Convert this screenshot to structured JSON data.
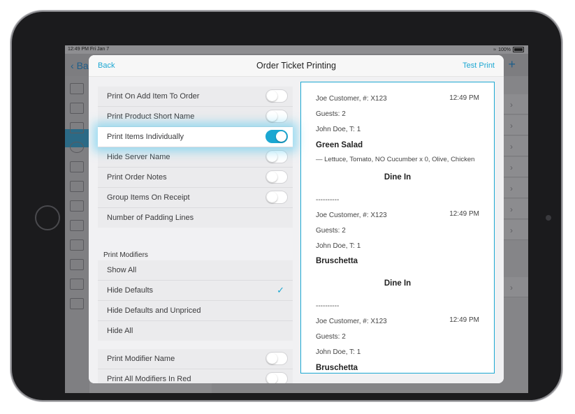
{
  "status_bar": {
    "time": "12:49 PM  Fri Jan 7",
    "battery": "100%"
  },
  "background_app": {
    "back_label": "Ba",
    "plus": "+"
  },
  "modal": {
    "back_label": "Back",
    "title": "Order Ticket Printing",
    "test_print_label": "Test Print"
  },
  "settings": [
    {
      "label": "Print On Add Item To Order",
      "on": false
    },
    {
      "label": "Print Product Short Name",
      "on": false
    },
    {
      "label": "Print Items Individually",
      "on": true
    },
    {
      "label": "Hide Server Name",
      "on": false
    },
    {
      "label": "Print Order Notes",
      "on": false
    },
    {
      "label": "Group Items On Receipt",
      "on": false
    },
    {
      "label": "Number of Padding Lines"
    }
  ],
  "print_modifiers": {
    "title": "Print Modifiers",
    "options": [
      "Show All",
      "Hide Defaults",
      "Hide Defaults and Unpriced",
      "Hide All"
    ],
    "selected": "Hide Defaults"
  },
  "modifier_settings": [
    {
      "label": "Print Modifier Name",
      "on": false
    },
    {
      "label": "Print All Modifiers In Red",
      "on": false
    }
  ],
  "preview": {
    "tickets": [
      {
        "customer": "Joe Customer, #: X123",
        "time": "12:49 PM",
        "guests": "Guests: 2",
        "server": "John Doe, T: 1",
        "item": "Green Salad",
        "modifiers": "— Lettuce, Tomato, NO Cucumber x 0, Olive, Chicken",
        "order_type": "Dine In",
        "separator": "----------"
      },
      {
        "customer": "Joe Customer, #: X123",
        "time": "12:49 PM",
        "guests": "Guests: 2",
        "server": "John Doe, T: 1",
        "item": "Bruschetta",
        "order_type": "Dine In",
        "separator": "----------"
      },
      {
        "customer": "Joe Customer, #: X123",
        "time": "12:49 PM",
        "guests": "Guests: 2",
        "server": "John Doe, T: 1",
        "item": "Bruschetta"
      }
    ]
  },
  "colors": {
    "accent": "#1ba7d2",
    "toggle_on": "#1ba7d2"
  }
}
